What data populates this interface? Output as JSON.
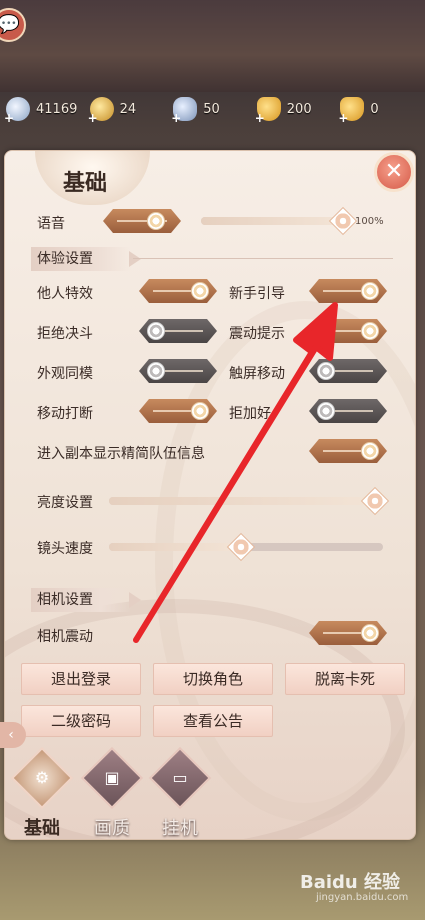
{
  "currencies": [
    {
      "icon": "silver-coin-icon",
      "value": "41169"
    },
    {
      "icon": "gold-coin-icon",
      "value": "24"
    },
    {
      "icon": "silver-ingot-icon",
      "value": "50"
    },
    {
      "icon": "gold-ingot-icon",
      "value": "200"
    },
    {
      "icon": "gold-ingot-small-icon",
      "value": "0"
    }
  ],
  "panel": {
    "title": "基础",
    "close_icon": "close-icon"
  },
  "sound": {
    "label": "语音",
    "volume_label": "100%",
    "enabled": true,
    "volume": 100
  },
  "experience": {
    "section_label": "体验设置",
    "items": [
      {
        "label": "他人特效",
        "on": true
      },
      {
        "label": "新手引导",
        "on": true
      },
      {
        "label": "拒绝决斗",
        "on": false
      },
      {
        "label": "震动提示",
        "on": true
      },
      {
        "label": "外观同模",
        "on": false
      },
      {
        "label": "触屏移动",
        "on": false
      },
      {
        "label": "移动打断",
        "on": true
      },
      {
        "label": "拒加好",
        "on": false
      },
      {
        "label": "进入副本显示精简队伍信息",
        "on": true
      }
    ]
  },
  "brightness": {
    "label": "亮度设置",
    "value": 100
  },
  "camera_speed": {
    "label": "镜头速度",
    "value": 48
  },
  "camera": {
    "section_label": "相机设置",
    "shake_label": "相机震动",
    "shake_on": true
  },
  "buttons": {
    "logout": "退出登录",
    "switch_role": "切换角色",
    "unstuck": "脱离卡死",
    "second_password": "二级密码",
    "announcement": "查看公告"
  },
  "tabs": [
    {
      "label": "基础",
      "icon": "gear-icon",
      "active": true
    },
    {
      "label": "画质",
      "icon": "picture-icon",
      "active": false
    },
    {
      "label": "挂机",
      "icon": "monitor-icon",
      "active": false
    }
  ],
  "watermark": {
    "text": "Baidu 经验",
    "sub": "jingyan.baidu.com"
  },
  "colors": {
    "toggle_on": "#b07248",
    "toggle_off": "#5a5454",
    "annotation_arrow": "#e8262a"
  }
}
